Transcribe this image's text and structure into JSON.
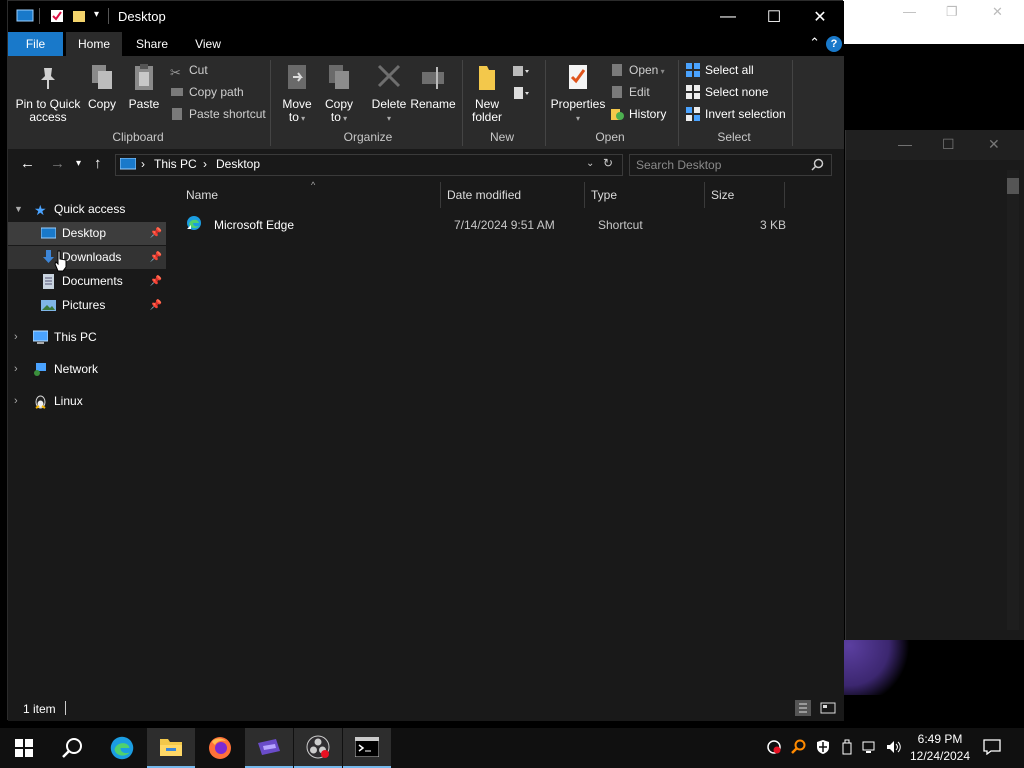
{
  "window": {
    "title": "Desktop",
    "minimize_glyph": "—",
    "maximize_glyph": "☐",
    "close_glyph": "✕"
  },
  "ribbon_tabs": [
    {
      "label": "File"
    },
    {
      "label": "Home"
    },
    {
      "label": "Share"
    },
    {
      "label": "View"
    }
  ],
  "ribbon": {
    "help_glyph": "?",
    "collapse_glyph": "⌃",
    "clipboard": {
      "pin_label_1": "Pin to Quick",
      "pin_label_2": "access",
      "copy_label": "Copy",
      "paste_label": "Paste",
      "cut_label": "Cut",
      "copy_path_label": "Copy path",
      "paste_shortcut_label": "Paste shortcut",
      "group_label": "Clipboard"
    },
    "organize": {
      "move_label_1": "Move",
      "move_label_2": "to",
      "copyto_label_1": "Copy",
      "copyto_label_2": "to",
      "delete_label": "Delete",
      "rename_label": "Rename",
      "group_label": "Organize"
    },
    "new": {
      "new_folder_label_1": "New",
      "new_folder_label_2": "folder",
      "group_label": "New"
    },
    "open": {
      "properties_label": "Properties",
      "open_label": "Open",
      "edit_label": "Edit",
      "history_label": "History",
      "group_label": "Open"
    },
    "select": {
      "select_all_label": "Select all",
      "select_none_label": "Select none",
      "invert_label": "Invert selection",
      "group_label": "Select"
    }
  },
  "address": {
    "segments": [
      "This PC",
      "Desktop"
    ],
    "separator": "›",
    "search_placeholder": "Search Desktop"
  },
  "nav_pane": {
    "quick_access": "Quick access",
    "items": [
      {
        "label": "Desktop",
        "icon": "desktop-icon",
        "pinned": true
      },
      {
        "label": "Downloads",
        "icon": "downloads-icon",
        "pinned": true
      },
      {
        "label": "Documents",
        "icon": "documents-icon",
        "pinned": true
      },
      {
        "label": "Pictures",
        "icon": "pictures-icon",
        "pinned": true
      }
    ],
    "this_pc": "This PC",
    "network": "Network",
    "linux": "Linux"
  },
  "file_list": {
    "columns": [
      "Name",
      "Date modified",
      "Type",
      "Size"
    ],
    "rows": [
      {
        "name": "Microsoft Edge",
        "date": "7/14/2024 9:51 AM",
        "type": "Shortcut",
        "size": "3 KB"
      }
    ]
  },
  "status": {
    "item_count": "1 item"
  },
  "clock": {
    "time": "6:49 PM",
    "date": "12/24/2024"
  },
  "colors": {
    "accent": "#1979ca",
    "window_bg": "#191919",
    "ribbon_bg": "#2b2b2b",
    "taskbar_bg": "#101010"
  }
}
